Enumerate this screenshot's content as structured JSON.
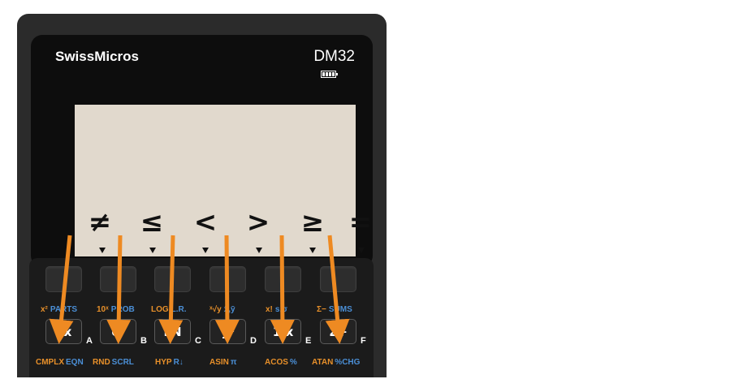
{
  "brand": "SwissMicros",
  "model": "DM32",
  "menu": {
    "labels": [
      "≠",
      "≤",
      "<",
      ">",
      "≥",
      "="
    ]
  },
  "keys": [
    {
      "main": "√x",
      "shift_f": "x²",
      "shift_g": "PARTS",
      "alpha": "A",
      "bottom_f": "CMPLX",
      "bottom_g": "EQN"
    },
    {
      "main": "eˣ",
      "shift_f": "10ˣ",
      "shift_g": "PROB",
      "alpha": "B",
      "bottom_f": "RND",
      "bottom_g": "SCRL"
    },
    {
      "main": "LN",
      "shift_f": "LOG",
      "shift_g": "L.R.",
      "alpha": "C",
      "bottom_f": "HYP",
      "bottom_g": "R↓"
    },
    {
      "main": "yˣ",
      "shift_f": "ˣ√y",
      "shift_g": "x̄,ȳ",
      "alpha": "D",
      "bottom_f": "ASIN",
      "bottom_g": "π"
    },
    {
      "main": "1/x",
      "shift_f": "x!",
      "shift_g": "s,σ",
      "alpha": "E",
      "bottom_f": "ACOS",
      "bottom_g": "%"
    },
    {
      "main": "Σ+",
      "shift_f": "Σ−",
      "shift_g": "SUMS",
      "alpha": "F",
      "bottom_f": "ATAN",
      "bottom_g": "%CHG"
    }
  ],
  "colors": {
    "arrow": "#ee8a22",
    "shift_f": "#e8902a",
    "shift_g": "#4b8fd6",
    "lcd": "#e1d9cd"
  }
}
